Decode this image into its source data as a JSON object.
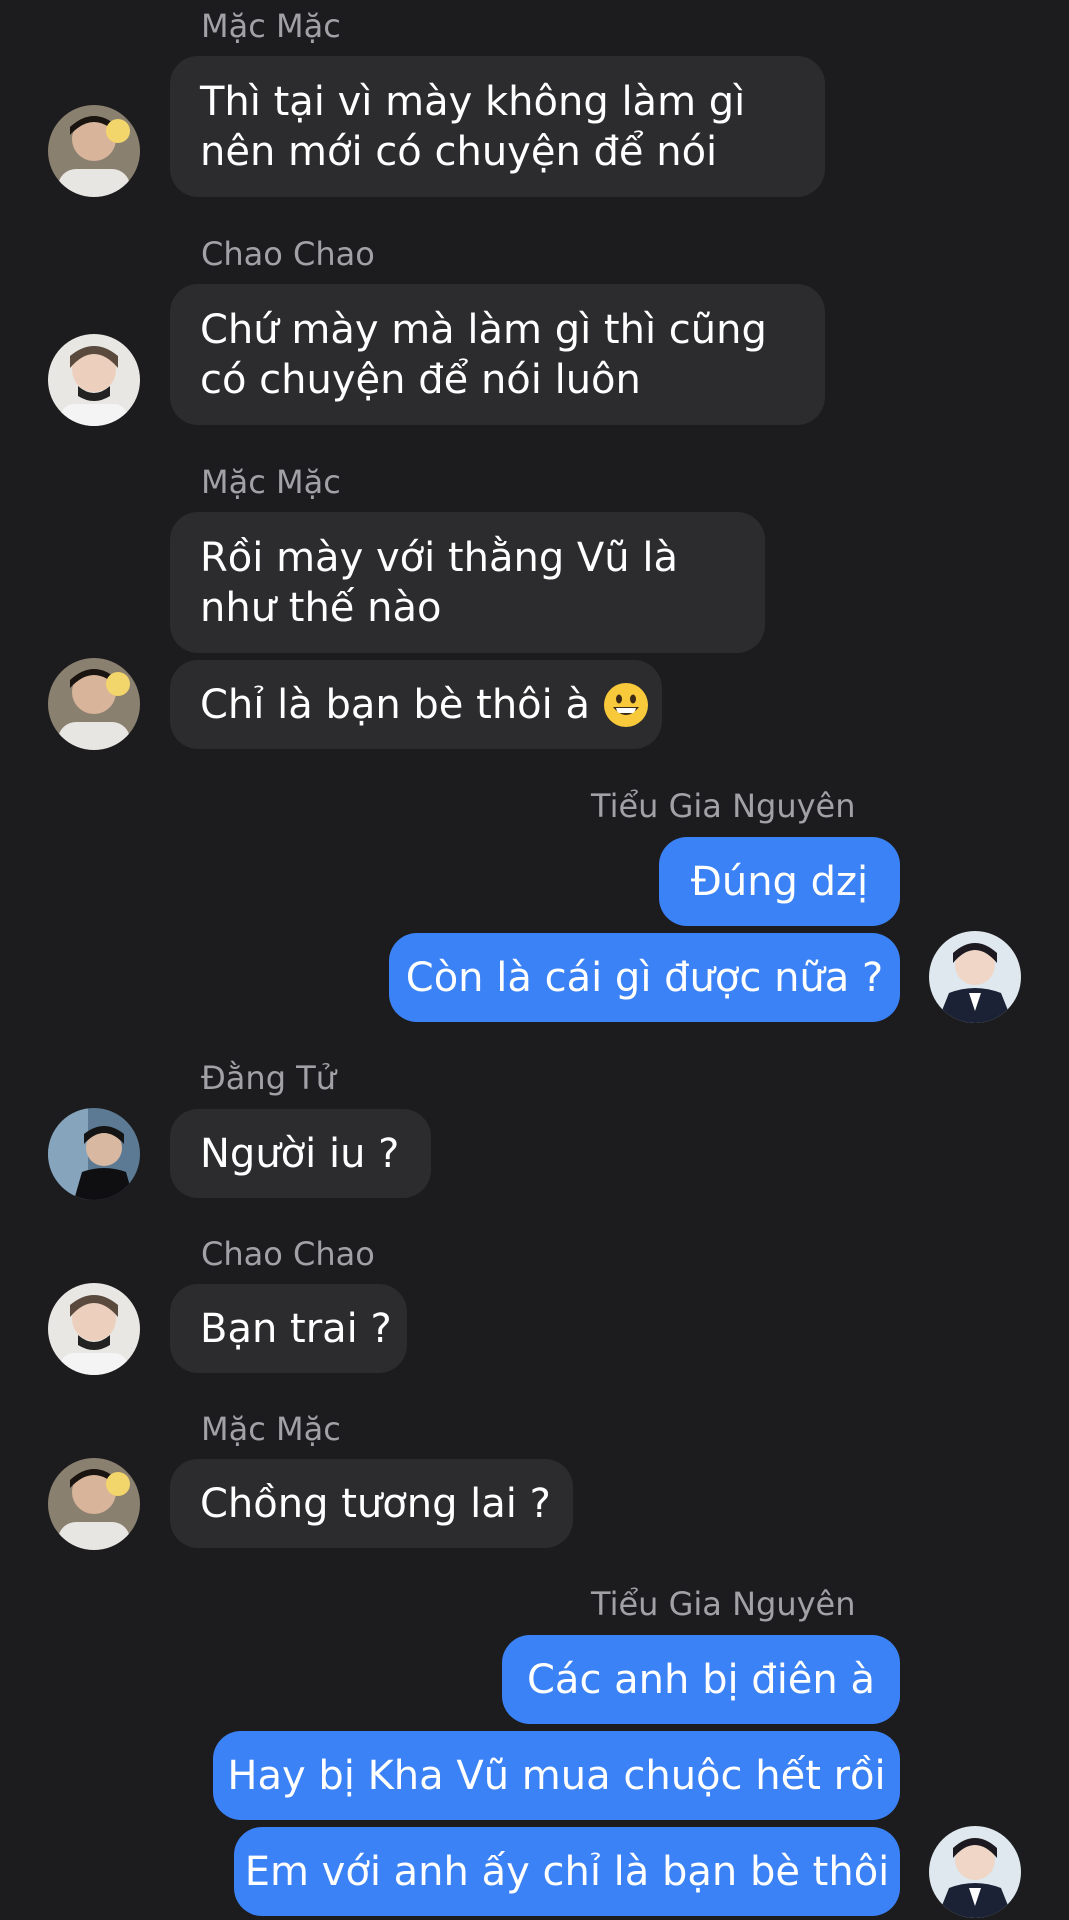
{
  "messages": [
    {
      "sender": "Mặc Mặc",
      "text": "Thì tại vì mày không làm gì nên mới có chuyện để nói"
    },
    {
      "sender": "Chao Chao",
      "text": "Chứ mày mà làm gì thì cũng có chuyện để nói luôn"
    },
    {
      "sender": "Mặc Mặc",
      "text": "Rồi mày với thằng Vũ là như thế nào"
    },
    {
      "text": "Chỉ là bạn bè thôi à"
    },
    {
      "sender": "Tiểu Gia Nguyên",
      "text": "Đúng dzị"
    },
    {
      "text": "Còn là cái gì được nữa ?"
    },
    {
      "sender": "Đằng Tử",
      "text": "Người iu ?"
    },
    {
      "sender": "Chao Chao",
      "text": "Bạn trai ?"
    },
    {
      "sender": "Mặc Mặc",
      "text": "Chồng tương lai ?"
    },
    {
      "sender": "Tiểu Gia Nguyên",
      "text": "Các anh bị điên à"
    },
    {
      "text": "Hay bị Kha Vũ mua chuộc hết rồi"
    },
    {
      "text": "Em với anh ấy chỉ là bạn bè thôi"
    }
  ],
  "emoji": "grinning-face-emoji",
  "colors": {
    "background": "#1c1c1e",
    "incoming_bubble": "#2c2c2e",
    "outgoing_bubble": "#3b82f6",
    "sender_name": "#a1a1a6"
  }
}
